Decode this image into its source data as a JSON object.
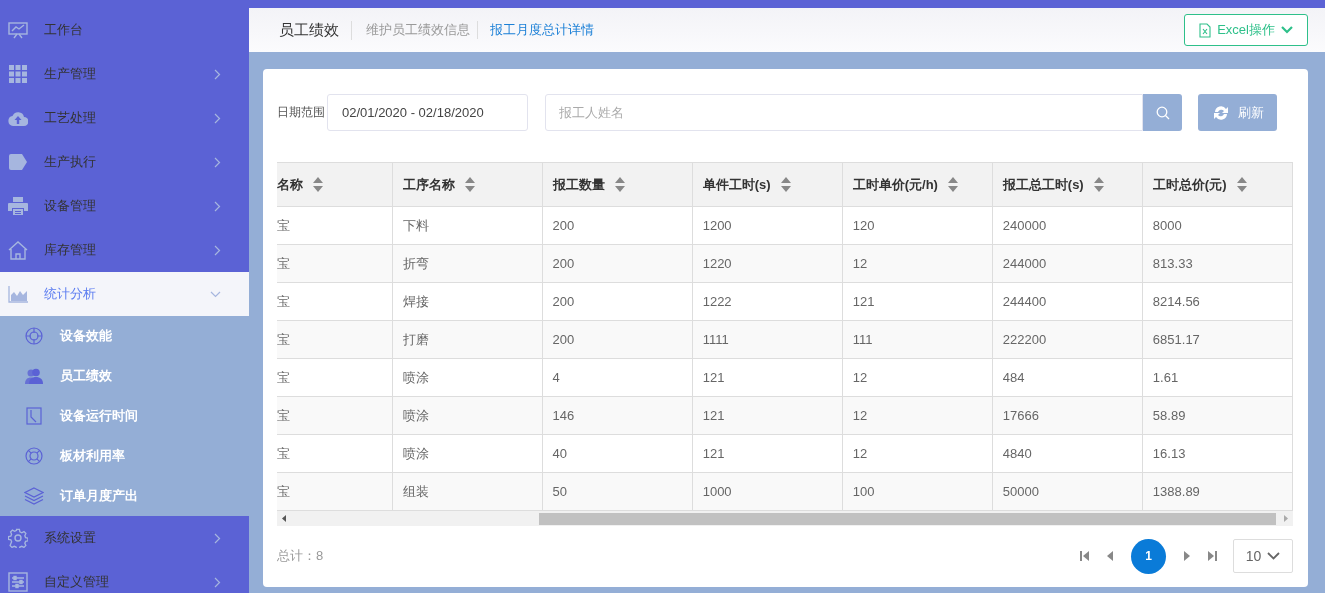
{
  "sidebar": {
    "items": [
      {
        "label": "工作台",
        "kind": "link",
        "expanded": false
      },
      {
        "label": "生产管理",
        "kind": "group",
        "expanded": false
      },
      {
        "label": "工艺处理",
        "kind": "group",
        "expanded": false
      },
      {
        "label": "生产执行",
        "kind": "group",
        "expanded": false
      },
      {
        "label": "设备管理",
        "kind": "group",
        "expanded": false
      },
      {
        "label": "库存管理",
        "kind": "group",
        "expanded": false
      },
      {
        "label": "统计分析",
        "kind": "group",
        "expanded": true,
        "children": [
          {
            "label": "设备效能"
          },
          {
            "label": "员工绩效"
          },
          {
            "label": "设备运行时间"
          },
          {
            "label": "板材利用率"
          },
          {
            "label": "订单月度产出"
          }
        ]
      },
      {
        "label": "系统设置",
        "kind": "group",
        "expanded": false
      },
      {
        "label": "自定义管理",
        "kind": "group",
        "expanded": false
      }
    ]
  },
  "header": {
    "title": "员工绩效",
    "subtitle": "维护员工绩效信息",
    "link": "报工月度总计详情",
    "excel_button": "Excel操作"
  },
  "filters": {
    "date_label": "日期范围",
    "date_range": "02/01/2020 - 02/18/2020",
    "name_placeholder": "报工人姓名",
    "refresh_button": "刷新"
  },
  "table": {
    "columns": [
      "名称",
      "工序名称",
      "报工数量",
      "单件工时(s)",
      "工时单价(元/h)",
      "报工总工时(s)",
      "工时总价(元)"
    ],
    "rows": [
      [
        "宝",
        "下料",
        "200",
        "1200",
        "120",
        "240000",
        "8000"
      ],
      [
        "宝",
        "折弯",
        "200",
        "1220",
        "12",
        "244000",
        "813.33"
      ],
      [
        "宝",
        "焊接",
        "200",
        "1222",
        "121",
        "244400",
        "8214.56"
      ],
      [
        "宝",
        "打磨",
        "200",
        "1111",
        "111",
        "222200",
        "6851.17"
      ],
      [
        "宝",
        "喷涂",
        "4",
        "121",
        "12",
        "484",
        "1.61"
      ],
      [
        "宝",
        "喷涂",
        "146",
        "121",
        "12",
        "17666",
        "58.89"
      ],
      [
        "宝",
        "喷涂",
        "40",
        "121",
        "12",
        "4840",
        "16.13"
      ],
      [
        "宝",
        "组装",
        "50",
        "1000",
        "100",
        "50000",
        "1388.89"
      ]
    ]
  },
  "pagination": {
    "total": "总计：8",
    "pages": [
      {
        "label": "1",
        "selected": true
      }
    ],
    "page_size": "10"
  }
}
